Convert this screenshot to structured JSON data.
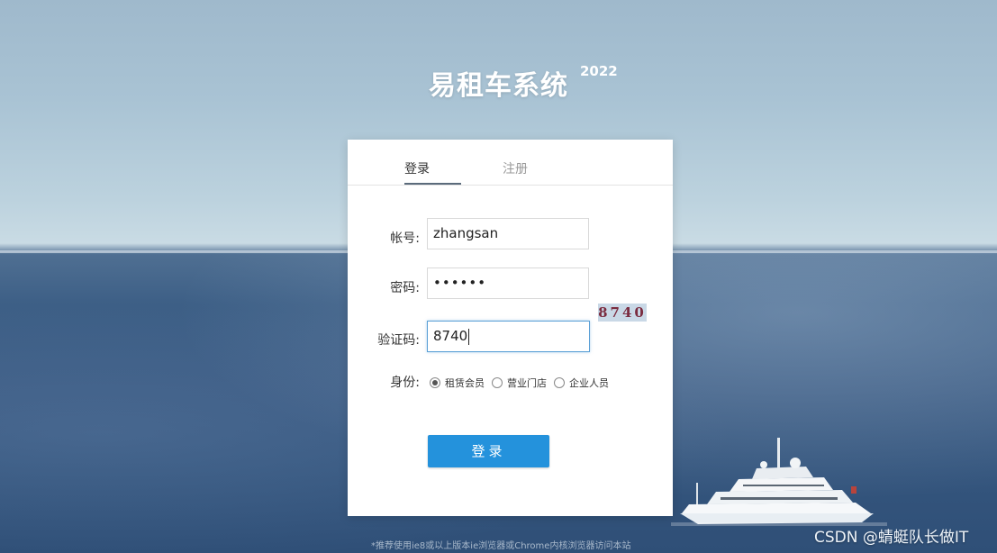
{
  "app": {
    "title": "易租车系统",
    "year": "2022"
  },
  "tabs": [
    {
      "label": "登录",
      "active": true
    },
    {
      "label": "注册",
      "active": false
    }
  ],
  "form": {
    "account_label": "帐号:",
    "account_value": "zhangsan",
    "password_label": "密码:",
    "password_value": "••••••",
    "captcha_label": "验证码:",
    "captcha_value": "8740",
    "captcha_image_text": "8740",
    "identity_label": "身份:",
    "identity_options": [
      {
        "label": "租赁会员",
        "checked": true
      },
      {
        "label": "营业门店",
        "checked": false
      },
      {
        "label": "企业人员",
        "checked": false
      }
    ],
    "submit_label": "登录"
  },
  "footer": {
    "note": "*推荐使用ie8或以上版本ie浏览器或Chrome内核浏览器访问本站"
  },
  "watermark": "CSDN @蜻蜓队长做IT",
  "colors": {
    "primary_button": "#2492dc",
    "focus_border": "#5a9fd6",
    "captcha_text": "#7a2b3f"
  },
  "icons": {
    "background": "ocean-yacht-background",
    "radio": "radio-icon"
  }
}
